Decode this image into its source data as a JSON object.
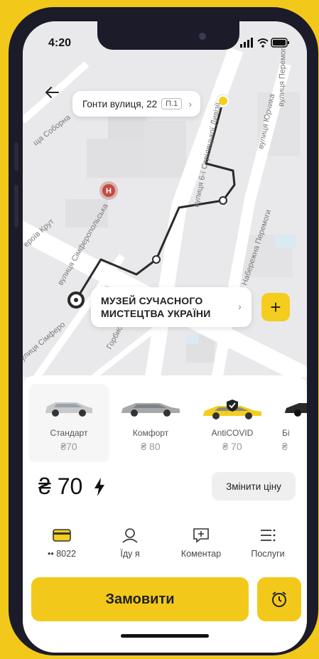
{
  "status": {
    "time": "4:20"
  },
  "map": {
    "pickup": {
      "street": "Гонти вулиця, 22",
      "entrance": "П.1"
    },
    "destination": {
      "line1": "МУЗЕЙ СУЧАСНОГО",
      "line2": "МИСТЕЦТВА УКРАЇНИ"
    },
    "street_labels": [
      "ща Соборна",
      "вулиця 6-ї Стрілецької Дивізії",
      "вулиця Перемоги",
      "вулиця Юрчика",
      "ероїв Крут",
      "вулиця Сімферопольська",
      "Набережна Перемоги",
      "Горбиста в",
      "улиця Сімферо"
    ],
    "hospital_marker": "H"
  },
  "tariffs": [
    {
      "name": "Стандарт",
      "price": "₴70",
      "selected": true,
      "car_color": "#c9c9c9"
    },
    {
      "name": "Комфорт",
      "price": "₴ 80",
      "selected": false,
      "car_color": "#a8a8a8"
    },
    {
      "name": "AntiCOVID",
      "price": "₴ 70",
      "selected": false,
      "car_color": "#f4cd1e"
    },
    {
      "name": "Бі",
      "price": "₴",
      "selected": false,
      "car_color": "#2a2a2a"
    }
  ],
  "price": {
    "value": "₴ 70",
    "change_label": "Змінити ціну"
  },
  "options": [
    {
      "icon": "card-icon",
      "label": "•• 8022"
    },
    {
      "icon": "person-icon",
      "label": "Їду я"
    },
    {
      "icon": "comment-icon",
      "label": "Коментар"
    },
    {
      "icon": "services-icon",
      "label": "Послуги"
    }
  ],
  "order_label": "Замовити",
  "colors": {
    "accent": "#f2c91a",
    "route": "#2a2a2a",
    "map_bg": "#e9e9eb"
  }
}
